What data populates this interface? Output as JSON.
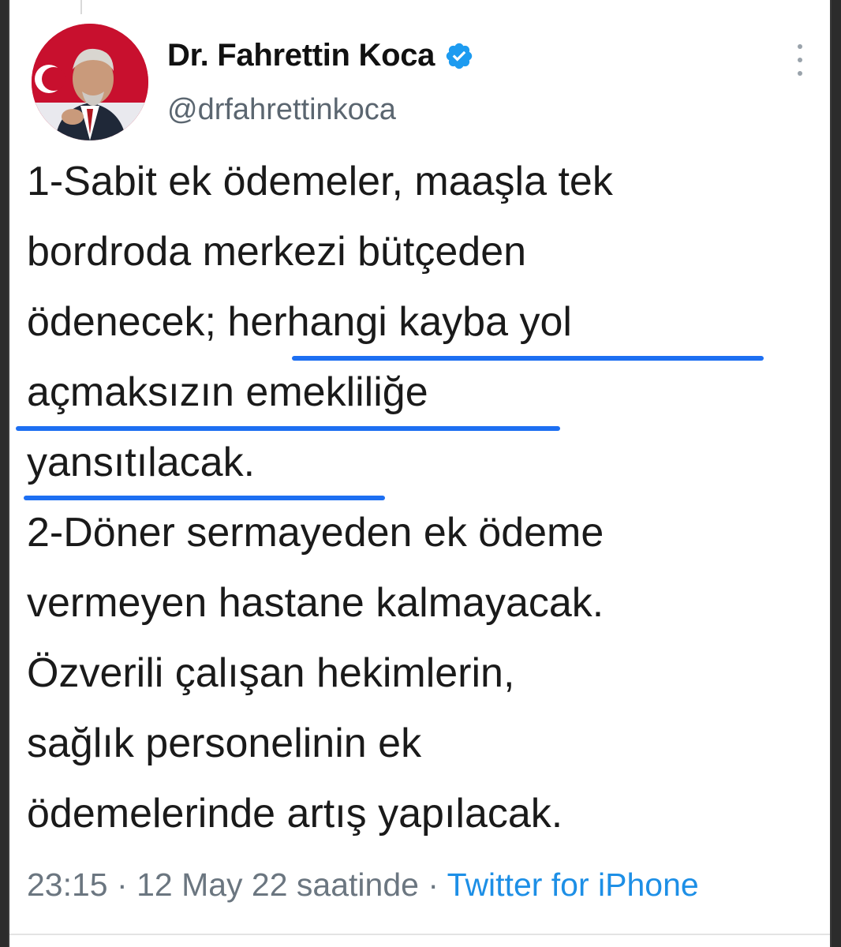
{
  "author": {
    "display_name": "Dr. Fahrettin Koca",
    "handle": "@drfahrettinkoca",
    "avatar_icon": "profile-photo-avatar",
    "verified_icon": "verified-badge-icon",
    "verified_color": "#1d9bf0"
  },
  "tweet": {
    "lines": [
      "1-Sabit ek ödemeler, maaşla tek",
      "bordroda merkezi bütçeden",
      "ödenecek; herhangi kayba yol",
      "açmaksızın emekliliğe",
      "yansıtılacak.",
      "2-Döner sermayeden ek ödeme",
      "vermeyen hastane kalmayacak.",
      "Özverili çalışan hekimlerin,",
      "sağlık personelinin ek",
      "ödemelerinde artış yapılacak."
    ],
    "underline_color": "#1d6ff2"
  },
  "meta": {
    "time": "23:15",
    "separator": "·",
    "date_text": "12 May 22 saatinde",
    "source": "Twitter for iPhone"
  },
  "menu": {
    "more_icon": "more-options-icon"
  }
}
